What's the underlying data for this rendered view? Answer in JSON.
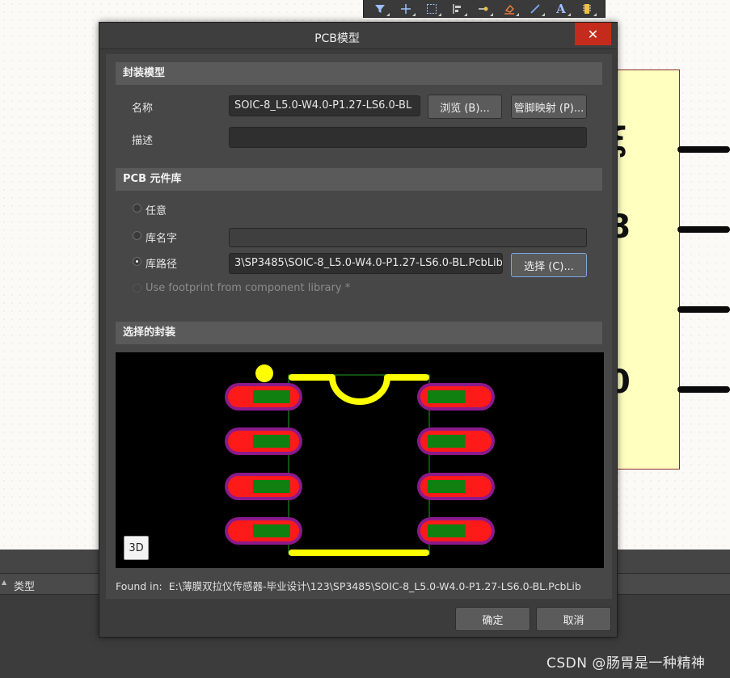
{
  "toolbar": {
    "icons": [
      "filter-icon",
      "plus-icon",
      "select-rect-icon",
      "align-icon",
      "pin-icon",
      "eraser-icon",
      "line-icon",
      "text-icon",
      "part-icon"
    ]
  },
  "background": {
    "panel_column_label": "类型"
  },
  "dialog": {
    "title": "PCB模型",
    "close_label": "✕",
    "footprint_model": {
      "header": "封装模型",
      "name_label": "名称",
      "name_value": "SOIC-8_L5.0-W4.0-P1.27-LS6.0-BL",
      "browse_label": "浏览 (B)...",
      "pin_map_label": "管脚映射 (P)...",
      "desc_label": "描述",
      "desc_value": ""
    },
    "pcb_library": {
      "header": "PCB 元件库",
      "option_any": "任意",
      "option_lib_name": "库名字",
      "lib_name_value": "",
      "option_lib_path": "库路径",
      "lib_path_value": "3\\SP3485\\SOIC-8_L5.0-W4.0-P1.27-LS6.0-BL.PcbLib",
      "choose_label": "选择 (C)...",
      "option_component_lib": "Use footprint from component library *",
      "selected_option": "lib_path"
    },
    "selected_footprint": {
      "header": "选择的封装",
      "btn_3d": "3D"
    },
    "found_in": {
      "label": "Found in:",
      "value": "E:\\薄膜双拉仪传感器-毕业设计\\123\\SP3485\\SOIC-8_L5.0-W4.0-P1.27-LS6.0-BL.PcbLib"
    },
    "ok_label": "确定",
    "cancel_label": "取消"
  },
  "watermark": "CSDN @肠胃是一种精神",
  "colors": {
    "pad_outer": "#8b1a8b",
    "pad_inner": "#ff1a1a",
    "pad_core": "#108010",
    "silkscreen": "#ffff00",
    "outline": "#1f9f1f",
    "close": "#c42b1c"
  }
}
